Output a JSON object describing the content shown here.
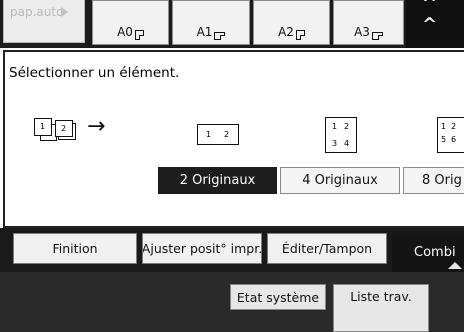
{
  "paper_row": {
    "auto_label": "pap.auto",
    "sizes": [
      {
        "label": "A0"
      },
      {
        "label": "A1"
      },
      {
        "label": "A2"
      },
      {
        "label": "A3"
      }
    ]
  },
  "panel": {
    "instruction": "Sélectionner un élément.",
    "illustration_pages": [
      "1",
      "2"
    ],
    "preview_two": [
      "1",
      "2"
    ],
    "preview_four": [
      "1",
      "2",
      "3",
      "4"
    ],
    "preview_eight": [
      "1",
      "2",
      "5",
      "6"
    ],
    "options": [
      {
        "label": "2 Originaux",
        "selected": true
      },
      {
        "label": "4 Originaux",
        "selected": false
      },
      {
        "label": "8 Orig",
        "selected": false
      }
    ]
  },
  "tabs": {
    "finition": "Finition",
    "ajuster": "Ajuster posit° impr.",
    "editer": "Éditer/Tampon",
    "combiner": "Combi"
  },
  "status": {
    "etat": "Etat système",
    "liste": "Liste trav."
  },
  "colors": {
    "selected_bg": "#1d1d1d",
    "frame": "#1a1a1a",
    "button_bg": "#f2f2f2"
  }
}
